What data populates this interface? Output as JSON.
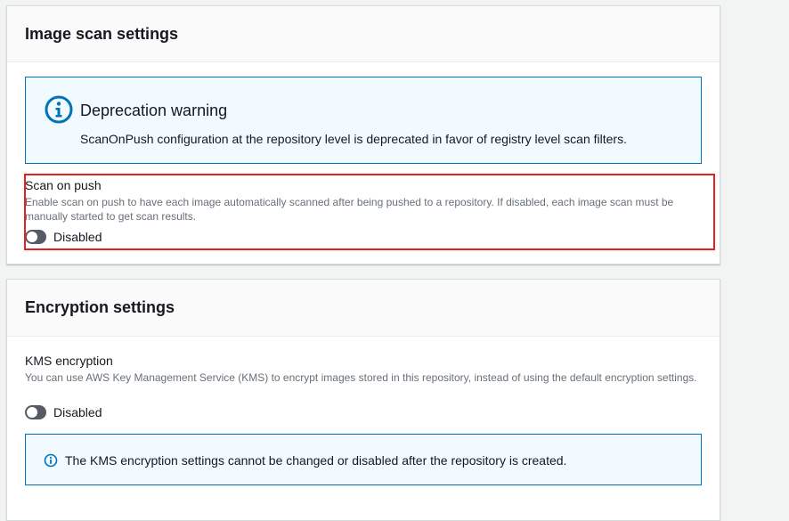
{
  "image_scan": {
    "title": "Image scan settings",
    "alert": {
      "heading": "Deprecation warning",
      "text": "ScanOnPush configuration at the repository level is deprecated in favor of registry level scan filters."
    },
    "scan_on_push": {
      "label": "Scan on push",
      "description": "Enable scan on push to have each image automatically scanned after being pushed to a repository. If disabled, each image scan must be manually started to get scan results.",
      "toggle_state": "Disabled"
    }
  },
  "encryption": {
    "title": "Encryption settings",
    "kms": {
      "label": "KMS encryption",
      "description": "You can use AWS Key Management Service (KMS) to encrypt images stored in this repository, instead of using the default encryption settings.",
      "toggle_state": "Disabled"
    },
    "info_text": "The KMS encryption settings cannot be changed or disabled after the repository is created."
  },
  "colors": {
    "info_blue": "#0073bb",
    "highlight_red": "#e81f1f",
    "toggle_off": "#545b64"
  },
  "icons": [
    "info-icon"
  ]
}
